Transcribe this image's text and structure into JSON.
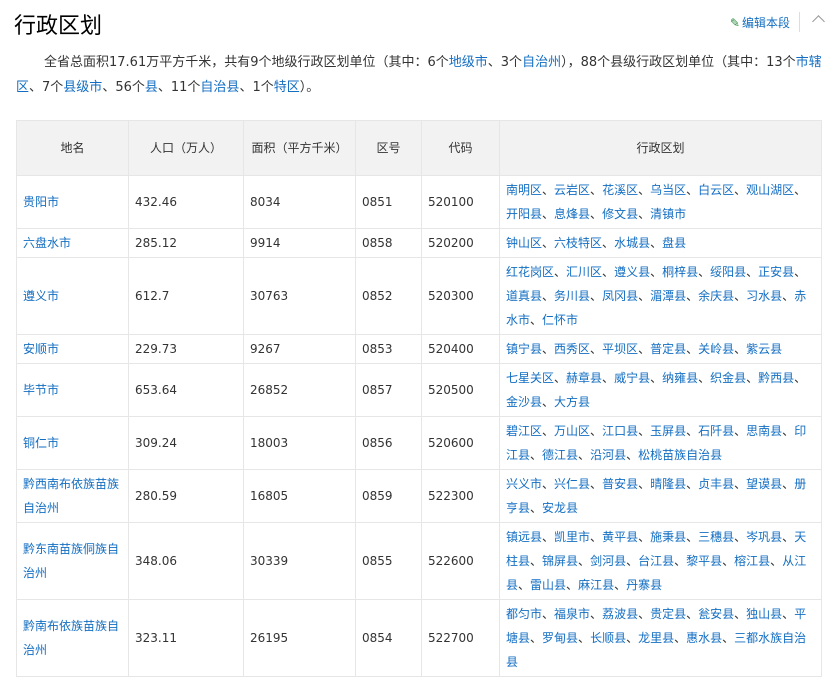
{
  "header": {
    "title": "行政区划",
    "edit_label": "编辑本段"
  },
  "summary": {
    "line_a": "全省总面积17.61万平方千米，共有9个地级行政区划单位（其中：6个",
    "link_prefecture_city": "地级市",
    "line_b": "、3个",
    "link_autonomous_prefecture": "自治州",
    "line_c": "），88个县级行政区划单位（其中：13个",
    "link_district": "市辖区",
    "line_d": "、7个",
    "link_county_city": "县级市",
    "line_e": "、56个",
    "link_county": "县",
    "line_f": "、11个",
    "link_autonomous_county": "自治县",
    "line_g": "、1个",
    "link_special_district": "特区",
    "line_h": "）。"
  },
  "table": {
    "headers": [
      "地名",
      "人口（万人）",
      "面积（平方千米）",
      "区号",
      "代码",
      "行政区划"
    ],
    "rows": [
      {
        "name": "贵阳市",
        "population": "432.46",
        "area": "8034",
        "area_code": "0851",
        "code": "520100",
        "divisions": [
          "南明区",
          "云岩区",
          "花溪区",
          "乌当区",
          "白云区",
          "观山湖区",
          "开阳县",
          "息烽县",
          "修文县",
          "清镇市"
        ]
      },
      {
        "name": "六盘水市",
        "population": "285.12",
        "area": "9914",
        "area_code": "0858",
        "code": "520200",
        "divisions": [
          "钟山区",
          "六枝特区",
          "水城县",
          "盘县"
        ]
      },
      {
        "name": "遵义市",
        "population": "612.7",
        "area": "30763",
        "area_code": "0852",
        "code": "520300",
        "divisions": [
          "红花岗区",
          "汇川区",
          "遵义县",
          "桐梓县",
          "绥阳县",
          "正安县",
          "道真县",
          "务川县",
          "凤冈县",
          "湄潭县",
          "余庆县",
          "习水县",
          "赤水市",
          "仁怀市"
        ]
      },
      {
        "name": "安顺市",
        "population": "229.73",
        "area": "9267",
        "area_code": "0853",
        "code": "520400",
        "divisions": [
          "镇宁县",
          "西秀区",
          "平坝区",
          "普定县",
          "关岭县",
          "紫云县"
        ]
      },
      {
        "name": "毕节市",
        "population": "653.64",
        "area": "26852",
        "area_code": "0857",
        "code": "520500",
        "divisions": [
          "七星关区",
          "赫章县",
          "威宁县",
          "纳雍县",
          "织金县",
          "黔西县",
          "金沙县",
          "大方县"
        ]
      },
      {
        "name": "铜仁市",
        "population": "309.24",
        "area": "18003",
        "area_code": "0856",
        "code": "520600",
        "divisions": [
          "碧江区",
          "万山区",
          "江口县",
          "玉屏县",
          "石阡县",
          "思南县",
          "印江县",
          "德江县",
          "沿河县",
          "松桃苗族自治县"
        ]
      },
      {
        "name": "黔西南布依族苗族自治州",
        "population": "280.59",
        "area": "16805",
        "area_code": "0859",
        "code": "522300",
        "divisions": [
          "兴义市",
          "兴仁县",
          "普安县",
          "晴隆县",
          "贞丰县",
          "望谟县",
          "册亨县",
          "安龙县"
        ]
      },
      {
        "name": "黔东南苗族侗族自治州",
        "population": "348.06",
        "area": "30339",
        "area_code": "0855",
        "code": "522600",
        "divisions": [
          "镇远县",
          "凯里市",
          "黄平县",
          "施秉县",
          "三穗县",
          "岑巩县",
          "天柱县",
          "锦屏县",
          "剑河县",
          "台江县",
          "黎平县",
          "榕江县",
          "从江县",
          "雷山县",
          "麻江县",
          "丹寨县"
        ]
      },
      {
        "name": "黔南布依族苗族自治州",
        "population": "323.11",
        "area": "26195",
        "area_code": "0854",
        "code": "522700",
        "divisions": [
          "都匀市",
          "福泉市",
          "荔波县",
          "贵定县",
          "瓮安县",
          "独山县",
          "平塘县",
          "罗甸县",
          "长顺县",
          "龙里县",
          "惠水县",
          "三都水族自治县"
        ]
      }
    ]
  }
}
